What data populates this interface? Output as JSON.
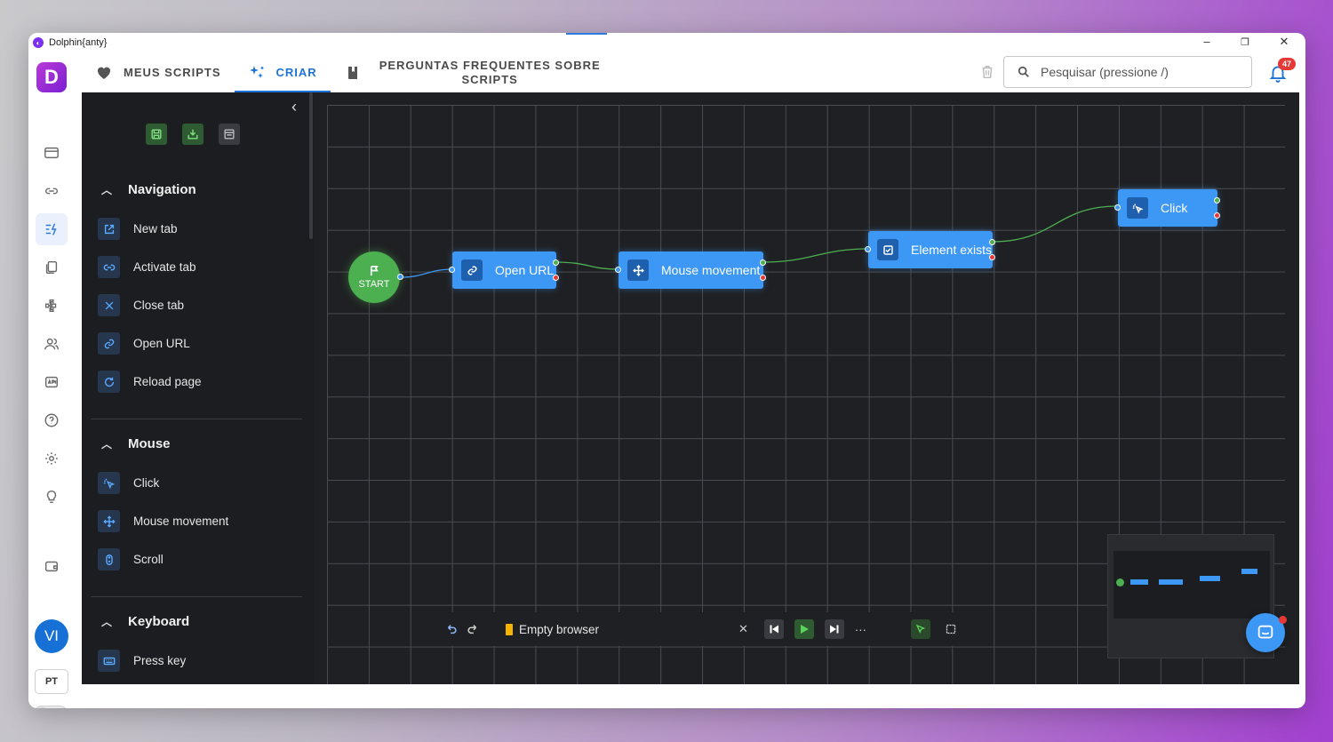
{
  "window": {
    "title": "Dolphin{anty}",
    "minimize": "–",
    "restore": "❐",
    "close": "✕"
  },
  "rail": {
    "brand": "D",
    "avatar": "VI",
    "lang": "PT",
    "theme_sun": "☼"
  },
  "tabs": [
    {
      "label": "MEUS SCRIPTS",
      "icon": "heart-icon"
    },
    {
      "label": "CRIAR",
      "icon": "sparkle-icon"
    },
    {
      "label": "PERGUNTAS FREQUENTES SOBRE",
      "label2": "SCRIPTS",
      "icon": "book-icon"
    }
  ],
  "search": {
    "placeholder": "Pesquisar (pressione /)"
  },
  "notifications": {
    "count": "47"
  },
  "panel": {
    "collapse": "‹",
    "sections": [
      {
        "title": "Navigation",
        "items": [
          "New tab",
          "Activate tab",
          "Close tab",
          "Open URL",
          "Reload page"
        ]
      },
      {
        "title": "Mouse",
        "items": [
          "Click",
          "Mouse movement",
          "Scroll"
        ]
      },
      {
        "title": "Keyboard",
        "items": [
          "Press key"
        ]
      }
    ]
  },
  "canvas": {
    "start_label": "START",
    "nodes": [
      "Open URL",
      "Mouse movement",
      "Element exists",
      "Click"
    ]
  },
  "toolbar": {
    "browser": "Empty browser",
    "clear": "✕",
    "more": "···"
  },
  "colors": {
    "accent": "#1e73d8",
    "node_blue": "#3d98f5",
    "success": "#4caf50",
    "error": "#e53935",
    "canvas_bg": "#1f2023"
  }
}
